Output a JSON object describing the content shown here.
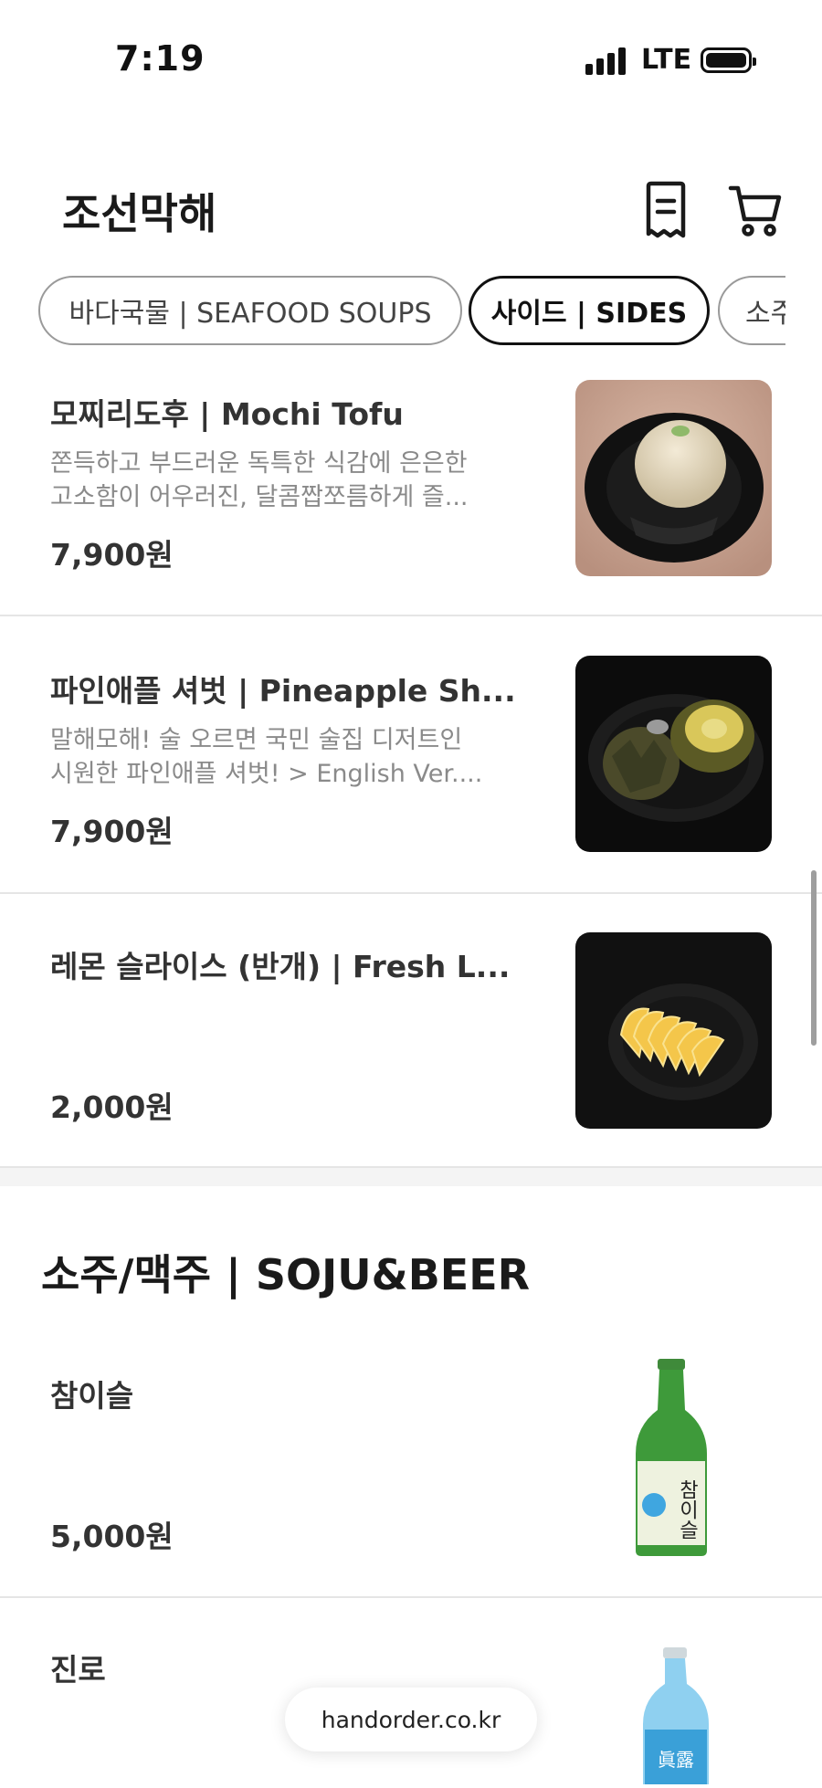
{
  "status_bar": {
    "time": "7:19",
    "network": "LTE"
  },
  "header": {
    "store_name": "조선막해"
  },
  "tabs": [
    {
      "label": "바다국물 | SEAFOOD SOUPS",
      "active": false
    },
    {
      "label": "사이드 | SIDES",
      "active": true
    },
    {
      "label": "소주",
      "active": false
    }
  ],
  "items": [
    {
      "name": "모찌리도후 | Mochi Tofu",
      "desc_line1": "쫀득하고 부드러운 독특한 식감에 은은한",
      "desc_line2": "고소함이 어우러진, 달콤짭쪼름하게 즐...",
      "price": "7,900원"
    },
    {
      "name": "파인애플 셔벗 | Pineapple Sh...",
      "desc_line1": "말해모해! 술 오르면 국민 술집 디저트인",
      "desc_line2": "시원한 파인애플 셔벗! > English Ver....",
      "price": "7,900원"
    },
    {
      "name": "레몬 슬라이스 (반개) | Fresh L...",
      "price": "2,000원"
    }
  ],
  "section": {
    "title": "소주/맥주 | SOJU&BEER"
  },
  "drinks": [
    {
      "name": "참이슬",
      "price": "5,000원",
      "label_text": "참이슬"
    },
    {
      "name": "진로",
      "label_text": "眞露"
    }
  ],
  "footer": {
    "domain": "handorder.co.kr"
  }
}
